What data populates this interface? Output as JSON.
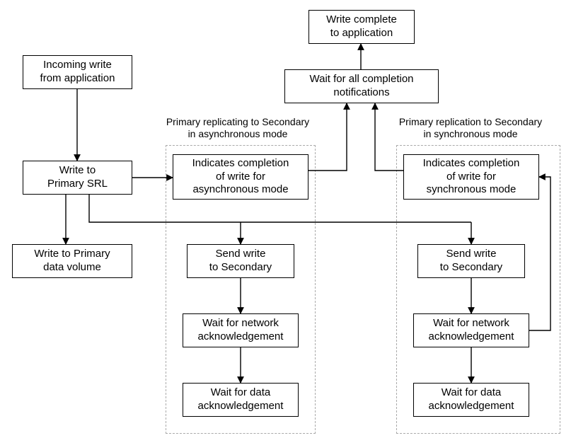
{
  "nodes": {
    "incoming": "Incoming write\nfrom application",
    "primary_srl": "Write to\nPrimary SRL",
    "data_volume": "Write to Primary\ndata volume",
    "async_complete": "Indicates completion\nof write for\nasynchronous mode",
    "sync_complete": "Indicates completion\nof write for\nsynchronous mode",
    "wait_all": "Wait for all completion\nnotifications",
    "write_done": "Write complete\nto application",
    "async_send": "Send write\nto Secondary",
    "async_net": "Wait for network\nacknowledgement",
    "async_data": "Wait for data\nacknowledgement",
    "sync_send": "Send write\nto Secondary",
    "sync_net": "Wait for network\nacknowledgement",
    "sync_data": "Wait for data\nacknowledgement"
  },
  "labels": {
    "async": "Primary replicating to Secondary\nin asynchronous mode",
    "sync": "Primary replication to Secondary\nin synchronous mode"
  }
}
